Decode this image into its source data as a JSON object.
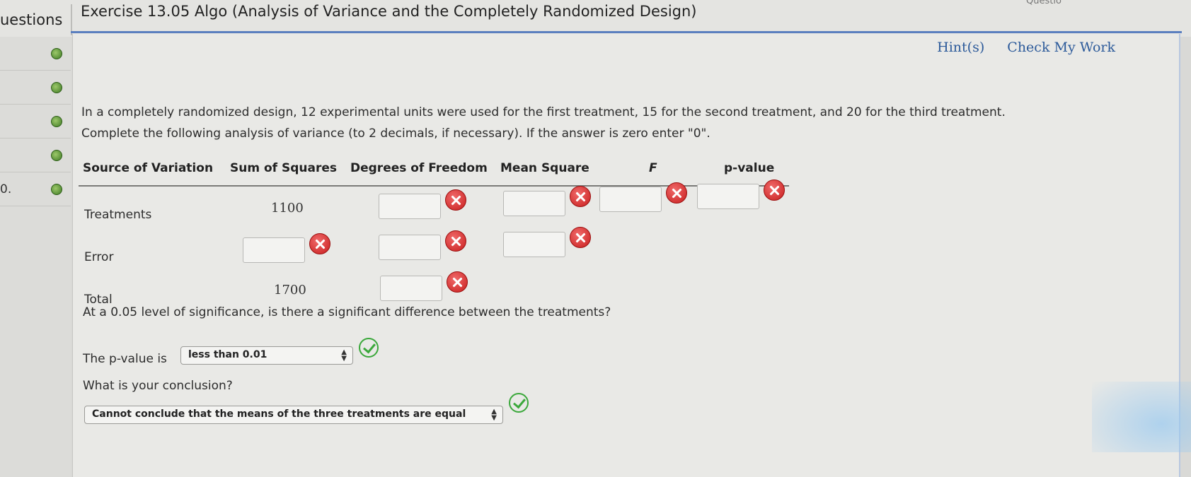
{
  "header": {
    "questions_tab": "uestions",
    "exercise_title": "Exercise 13.05 Algo (Analysis of Variance and the Completely Randomized Design)",
    "question_of": "Questio"
  },
  "sidebar": {
    "items": [
      {
        "num": "",
        "status": "complete"
      },
      {
        "num": "",
        "status": "complete"
      },
      {
        "num": "",
        "status": "complete"
      },
      {
        "num": "",
        "status": "complete"
      },
      {
        "num": "0.",
        "status": "complete"
      }
    ]
  },
  "links": {
    "hints": "Hint(s)",
    "check": "Check My Work"
  },
  "instructions": {
    "line1": "In a completely randomized design, 12 experimental units were used for the first treatment, 15 for the second treatment, and 20 for the third treatment.",
    "line2": "Complete the following analysis of variance (to 2 decimals, if necessary). If the answer is zero enter \"0\"."
  },
  "table": {
    "headers": [
      "Source of Variation",
      "Sum of Squares",
      "Degrees of Freedom",
      "Mean Square",
      "F",
      "p-value"
    ],
    "rows": [
      {
        "label": "Treatments",
        "ss": "1100"
      },
      {
        "label": "Error",
        "ss": ""
      },
      {
        "label": "Total",
        "ss": "1700"
      }
    ]
  },
  "question": {
    "prompt": "At a 0.05 level of significance, is there a significant difference between the treatments?",
    "pvalue_label": "The p-value is",
    "pvalue_selected": "less than 0.01",
    "conclusion_label": "What is your conclusion?",
    "conclusion_selected": "Cannot conclude that the means of the three treatments are equal"
  },
  "colors": {
    "accent": "#5b7fbf",
    "link": "#2c5a9a",
    "error": "#c81e1e",
    "correct": "#3ba83b"
  }
}
